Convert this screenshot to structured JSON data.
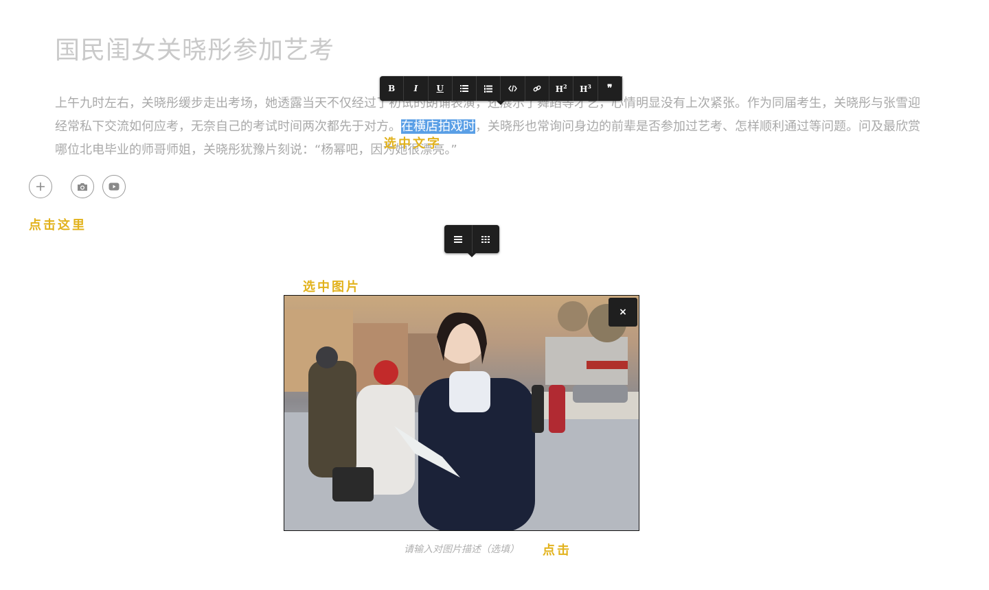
{
  "article": {
    "title": "国民闺女关晓彤参加艺考",
    "paragraph_before": "上午九时左右，关晓彤缓步走出考场，她透露当天不仅经过了初试的朗诵表演，还展示了舞蹈等才艺，心情明显没有上次紧张。作为同届考生，关晓彤与张雪迎经常私下交流如何应考，无奈自己的考试时间两次都先于对方。",
    "selected_text": "在横店拍戏时",
    "paragraph_after": "，关晓彤也常询问身边的前辈是否参加过艺考、怎样顺利通过等问题。问及最欣赏哪位北电毕业的师哥师姐，关晓彤犹豫片刻说：“杨幂吧，因为她很漂亮。”"
  },
  "text_toolbar": {
    "bold": "B",
    "italic": "I",
    "underline": "U",
    "h2": "H",
    "h2_sup": "2",
    "h3": "H",
    "h3_sup": "3",
    "quote": "❞",
    "icons": [
      "bold-icon",
      "italic-icon",
      "underline-icon",
      "unordered-list-icon",
      "ordered-list-icon",
      "code-icon",
      "link-icon",
      "h2-icon",
      "h3-icon",
      "quote-icon"
    ]
  },
  "annotations": {
    "select_text": "选中文字",
    "click_here": "点击这里",
    "select_image": "选中图片",
    "click": "点击"
  },
  "insert_buttons": {
    "plus": "+",
    "icons": [
      "plus-icon",
      "camera-icon",
      "video-icon"
    ]
  },
  "image_toolbar": {
    "icons": [
      "align-justify-icon",
      "grid-icon"
    ]
  },
  "image": {
    "close": "×",
    "caption_placeholder": "请输入对图片描述（选填）"
  },
  "colors": {
    "selection": "#5a9fe6",
    "toolbar_bg": "#1f1f1f",
    "annotation": "#e2b21c"
  }
}
